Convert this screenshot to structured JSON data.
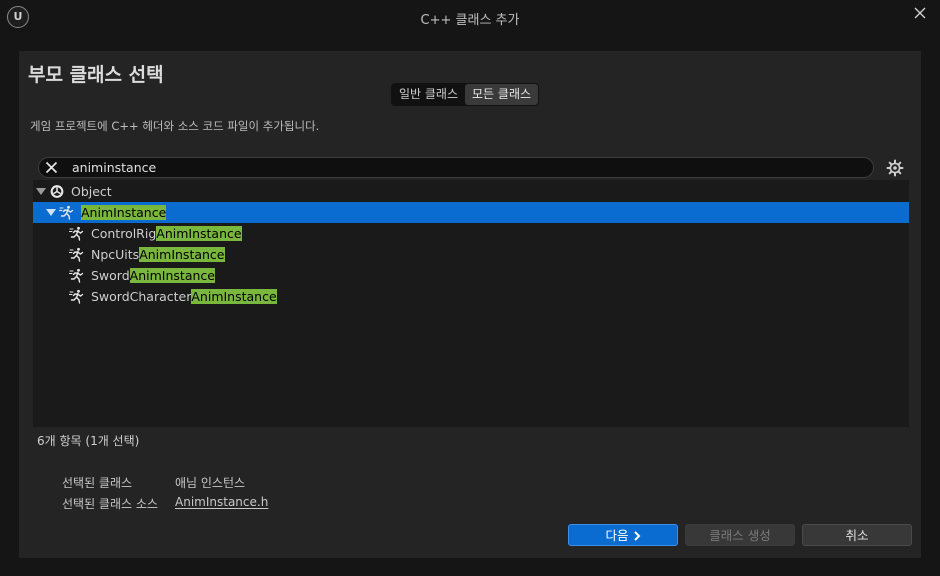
{
  "window": {
    "logo_text": "U",
    "title": "C++ 클래스 추가"
  },
  "heading": "부모 클래스 선택",
  "filter_tabs": [
    {
      "label": "일반 클래스",
      "active": false
    },
    {
      "label": "모든 클래스",
      "active": true
    }
  ],
  "description": "게임 프로젝트에 C++ 헤더와 소스 코드 파일이 추가됩니다.",
  "search": {
    "value": "animinstance"
  },
  "tree": {
    "root": {
      "label": "Object",
      "icon": "object-sphere-icon",
      "expanded": true
    },
    "selected": {
      "label": "AnimInstance",
      "icon": "anim-runner-icon",
      "expanded": true
    },
    "children": [
      {
        "prefix": "ControlRig",
        "match": "AnimInstance",
        "icon": "anim-runner-icon"
      },
      {
        "prefix": "NpcUits",
        "match": "AnimInstance",
        "icon": "anim-runner-icon"
      },
      {
        "prefix": "Sword",
        "match": "AnimInstance",
        "icon": "anim-runner-icon"
      },
      {
        "prefix": "SwordCharacter",
        "match": "AnimInstance",
        "icon": "anim-runner-icon"
      }
    ]
  },
  "count_text": "6개 항목 (1개 선택)",
  "info": {
    "selected_class_label": "선택된 클래스",
    "selected_class_value": "애님 인스턴스",
    "selected_source_label": "선택된 클래스 소스",
    "selected_source_value": "AnimInstance.h"
  },
  "buttons": {
    "next": "다음",
    "next_icon": "chevron-right-icon",
    "create": "클래스 생성",
    "create_enabled": false,
    "cancel": "취소"
  },
  "colors": {
    "accent": "#0a6bd1",
    "highlight": "#7ab73d",
    "panel": "#242424",
    "background": "#151515"
  }
}
